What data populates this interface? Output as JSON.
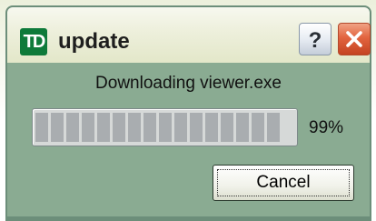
{
  "window": {
    "title": "update",
    "logo_text": "TD",
    "help_button_label": "?",
    "close_button_label": "✕"
  },
  "dialog": {
    "message": "Downloading viewer.exe",
    "progress_percent": 99,
    "progress_label": "99%",
    "cancel_label": "Cancel"
  },
  "icons": {
    "logo": "td-logo-icon",
    "help": "question-mark-icon",
    "close": "close-x-icon"
  },
  "colors": {
    "client_background": "#8aab92",
    "frame": "#6c8e7a",
    "logo_green": "#0e7a3a",
    "close_red": "#e2643f",
    "progress_segment": "#a9adb0",
    "progress_track": "#d6d9d8"
  }
}
